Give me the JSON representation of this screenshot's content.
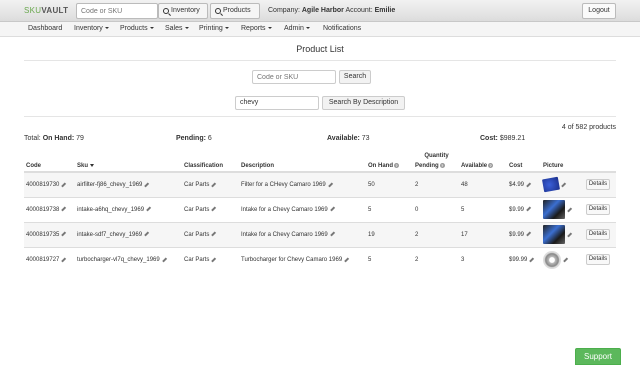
{
  "app": {
    "logo_sku": "SKU",
    "logo_vault": "VAULT"
  },
  "topbar": {
    "search_placeholder": "Code or SKU",
    "inventory_label": "Inventory",
    "products_label": "Products",
    "company_prefix": "Company:",
    "company_name": "Agile Harbor",
    "account_prefix": "Account:",
    "account_name": "Emilie",
    "logout_label": "Logout"
  },
  "nav": [
    {
      "label": "Dashboard",
      "dropdown": false
    },
    {
      "label": "Inventory",
      "dropdown": true
    },
    {
      "label": "Products",
      "dropdown": true
    },
    {
      "label": "Sales",
      "dropdown": true
    },
    {
      "label": "Printing",
      "dropdown": true
    },
    {
      "label": "Reports",
      "dropdown": true
    },
    {
      "label": "Admin",
      "dropdown": true
    },
    {
      "label": "Notifications",
      "dropdown": false
    }
  ],
  "page_title": "Product List",
  "search": {
    "code_placeholder": "Code or SKU",
    "search_label": "Search",
    "desc_value": "chevy",
    "desc_button": "Search By Description"
  },
  "result_count": "4 of 582 products",
  "totals": {
    "total_label": "Total:",
    "on_hand_label": "On Hand:",
    "on_hand": "79",
    "pending_label": "Pending:",
    "pending": "6",
    "available_label": "Available:",
    "available": "73",
    "cost_label": "Cost:",
    "cost": "$989.21"
  },
  "table": {
    "headers": {
      "code": "Code",
      "sku": "Sku",
      "classification": "Classification",
      "description": "Description",
      "quantity": "Quantity",
      "on_hand": "On Hand",
      "pending": "Pending",
      "available": "Available",
      "cost": "Cost",
      "picture": "Picture"
    },
    "details_label": "Details",
    "rows": [
      {
        "code": "4000819730",
        "sku": "airfilter-fj86_chevy_1969",
        "classification": "Car Parts",
        "description": "Filter for a CHevy Camaro 1969",
        "on_hand": "50",
        "pending": "2",
        "available": "48",
        "cost": "$4.99",
        "picture": "filter"
      },
      {
        "code": "4000819738",
        "sku": "intake-a6hq_chevy_1969",
        "classification": "Car Parts",
        "description": "Intake for a Chevy Camaro 1969",
        "on_hand": "5",
        "pending": "0",
        "available": "5",
        "cost": "$9.99",
        "picture": "intake"
      },
      {
        "code": "4000819735",
        "sku": "intake-sdf7_chevy_1969",
        "classification": "Car Parts",
        "description": "Intake for a Chevy Camaro 1969",
        "on_hand": "19",
        "pending": "2",
        "available": "17",
        "cost": "$9.99",
        "picture": "intake"
      },
      {
        "code": "4000819727",
        "sku": "turbocharger-vl7q_chevy_1969",
        "classification": "Car Parts",
        "description": "Turbocharger for Chevy Camaro 1969",
        "on_hand": "5",
        "pending": "2",
        "available": "3",
        "cost": "$99.99",
        "picture": "turbo"
      }
    ]
  },
  "support_label": "Support",
  "colors": {
    "brand_green": "#6aa84f",
    "support_green": "#5cb85c"
  }
}
